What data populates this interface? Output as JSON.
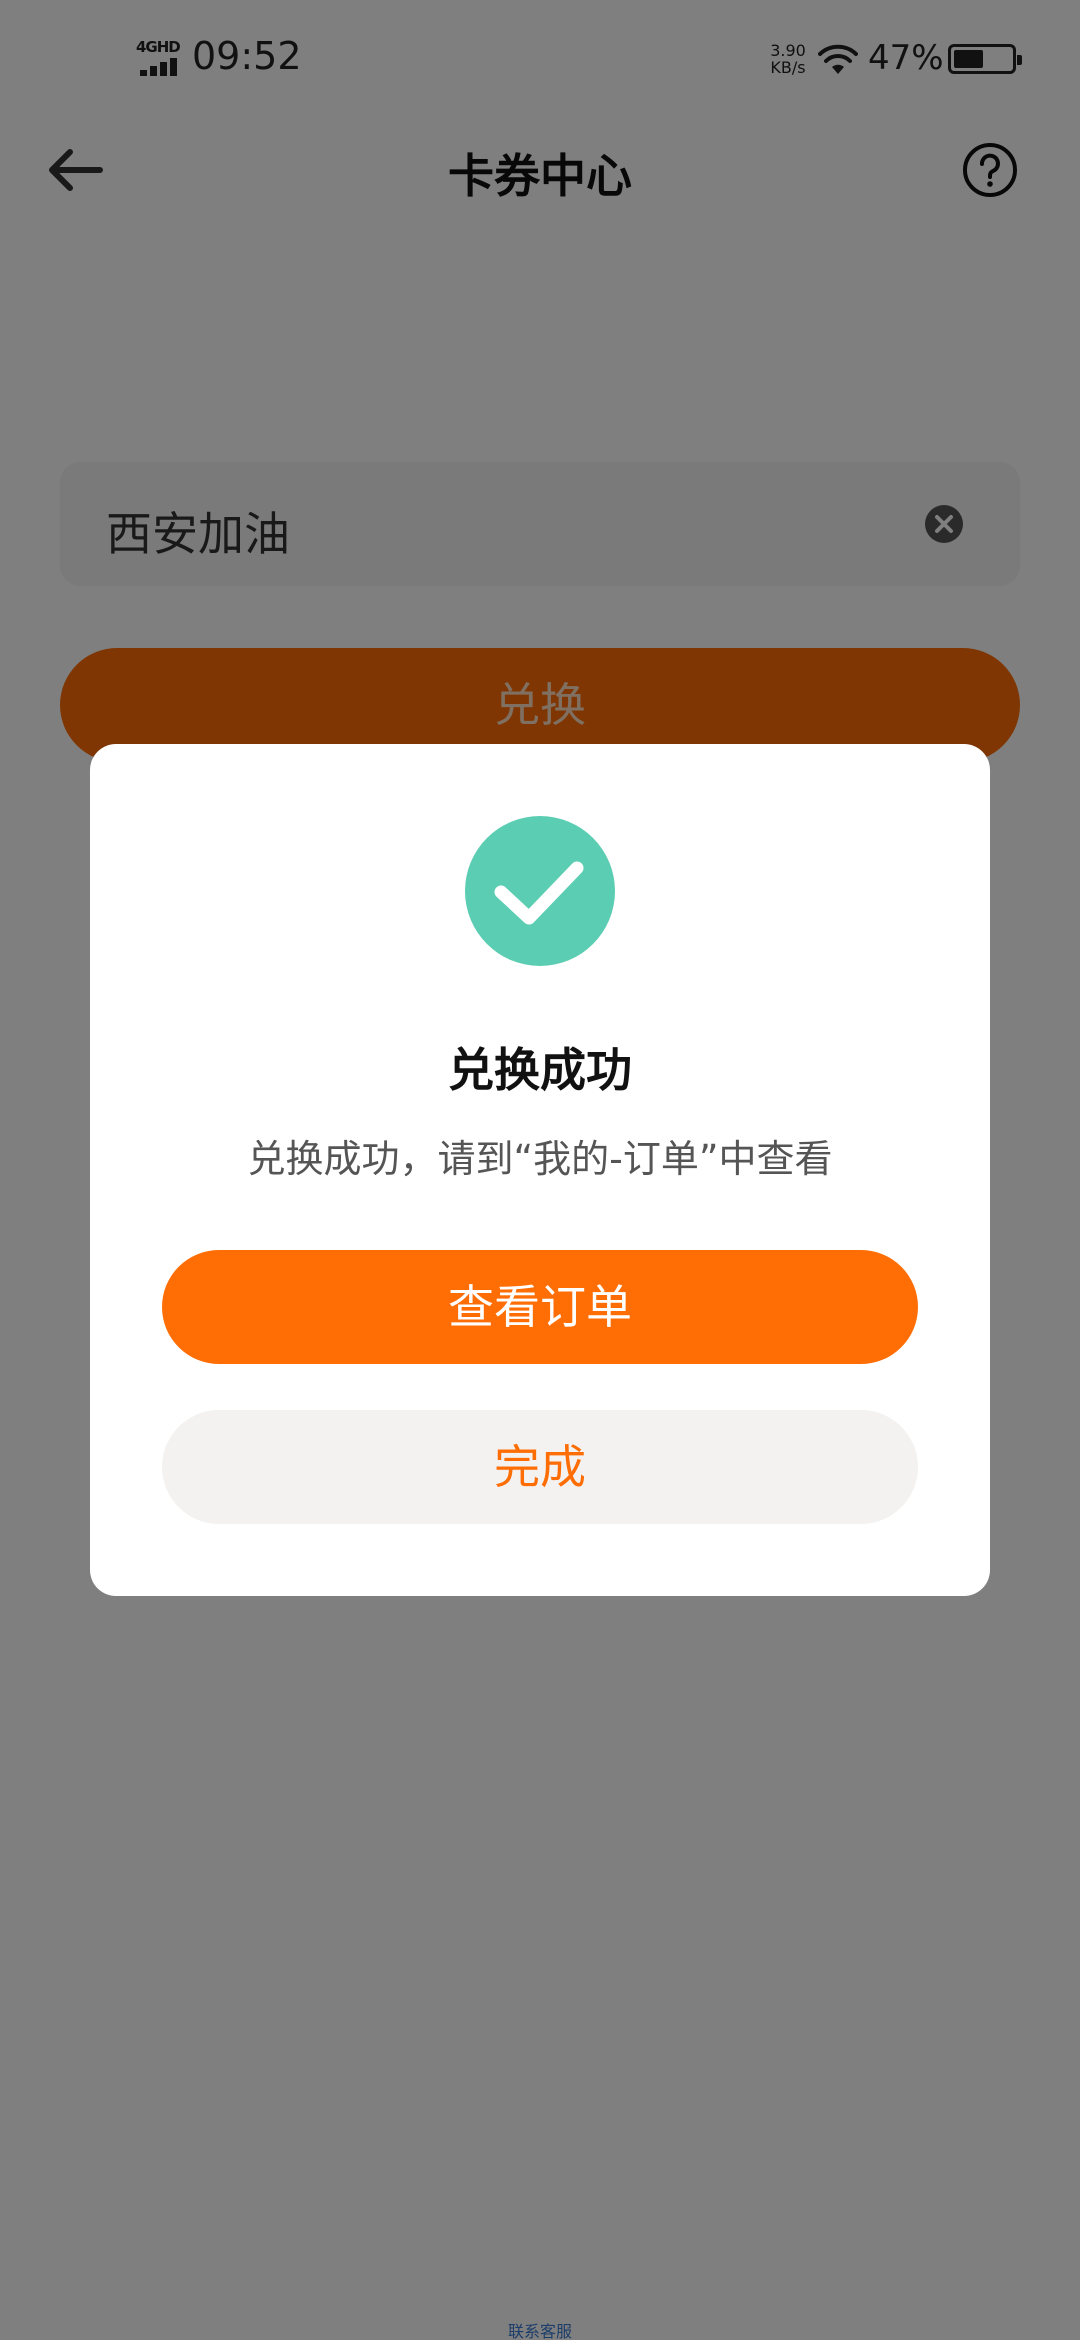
{
  "status_bar": {
    "network": "4GHD",
    "time": "09:52",
    "speed_value": "3.90",
    "speed_unit": "KB/s",
    "battery_pct": "47%",
    "battery_level": 0.47
  },
  "header": {
    "title": "卡券中心",
    "back_icon": "arrow-left-icon",
    "help_icon": "question-circle-icon"
  },
  "form": {
    "code_value": "西安加油",
    "clear_icon": "clear-circle-icon",
    "redeem_label": "兑换"
  },
  "dialog": {
    "icon": "check-circle-icon",
    "title": "兑换成功",
    "message": "兑换成功，请到“我的-订单”中查看",
    "primary_label": "查看订单",
    "secondary_label": "完成"
  },
  "footer": {
    "link_text": "联系客服"
  },
  "colors": {
    "accent": "#ff6d05",
    "success": "#5bcdb3",
    "overlay": "rgba(0,0,0,0.5)",
    "secondary_bg": "#f3f2f1"
  }
}
